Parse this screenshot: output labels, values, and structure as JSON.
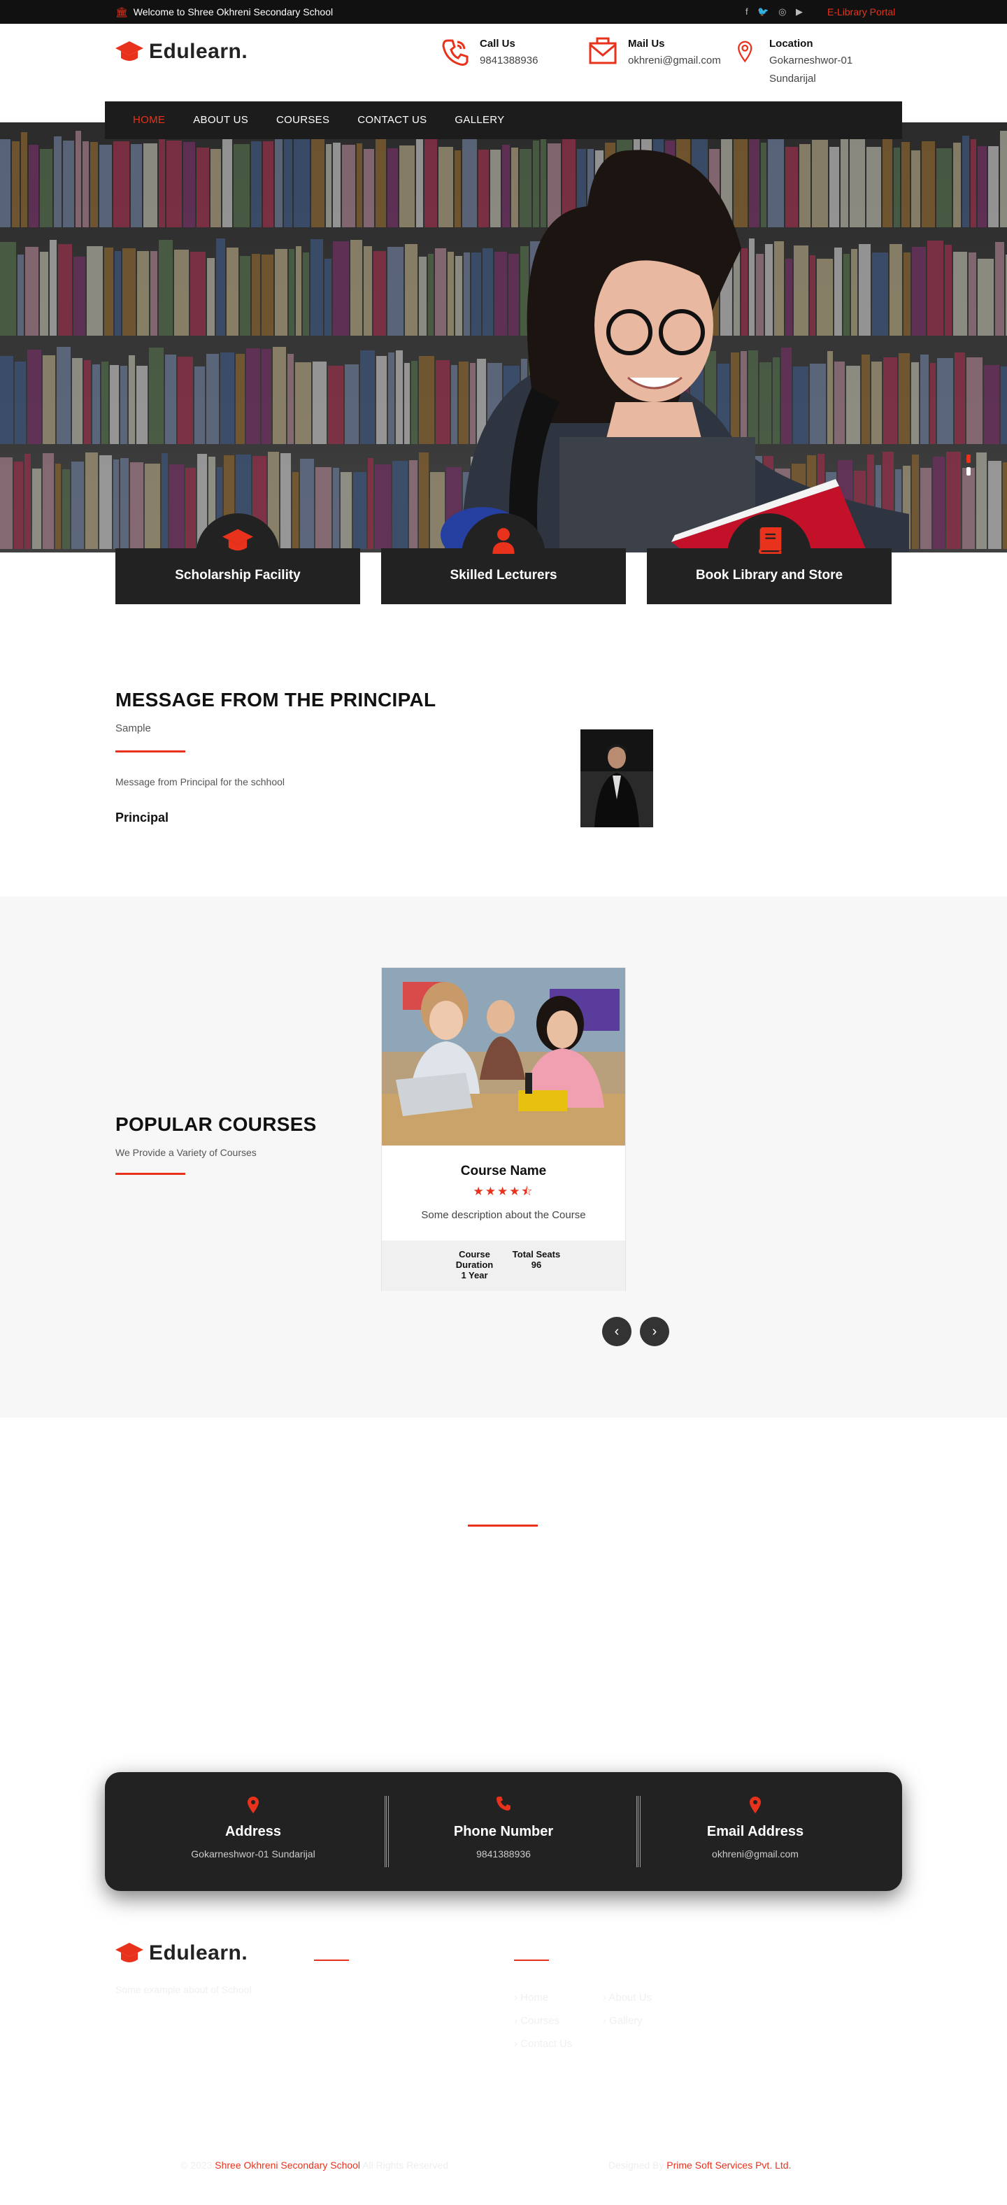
{
  "topbar": {
    "welcome": "Welcome to Shree Okhreni Secondary School",
    "social_icons": [
      "facebook-icon",
      "twitter-icon",
      "instagram-icon",
      "youtube-icon"
    ],
    "portal_link": "E-Library Portal"
  },
  "brand": {
    "name": "Edulearn.",
    "accent": "#e8321c",
    "dark": "#1c1c1c"
  },
  "header": {
    "call": {
      "label": "Call Us",
      "value": "9841388936"
    },
    "mail": {
      "label": "Mail Us",
      "value": "okhreni@gmail.com"
    },
    "location": {
      "label": "Location",
      "line1": "Gokarneshwor-01",
      "line2": "Sundarijal"
    }
  },
  "nav": {
    "items": [
      "HOME",
      "ABOUT US",
      "COURSES",
      "CONTACT US",
      "GALLERY"
    ],
    "active": "HOME"
  },
  "features": [
    {
      "icon": "graduation-cap-icon",
      "label": "Scholarship Facility"
    },
    {
      "icon": "user-icon",
      "label": "Skilled Lecturers"
    },
    {
      "icon": "book-icon",
      "label": "Book Library and Store"
    }
  ],
  "principal": {
    "heading": "MESSAGE FROM THE PRINCIPAL",
    "subtitle": "Sample",
    "message": "Message from Principal for the schhool",
    "signature": "Principal"
  },
  "courses": {
    "heading": "POPULAR COURSES",
    "subtitle": "We Provide a Variety of Courses",
    "card": {
      "name": "Course Name",
      "rating": 4.5,
      "stars": "★★★★⯪",
      "description": "Some description about the Course",
      "duration_label": "Course Duration",
      "duration_value": "1 Year",
      "seats_label": "Total Seats",
      "seats_value": "96"
    }
  },
  "contact": {
    "address": {
      "label": "Address",
      "value": "Gokarneshwor-01 Sundarijal"
    },
    "phone": {
      "label": "Phone Number",
      "value": "9841388936"
    },
    "email": {
      "label": "Email Address",
      "value": "okhreni@gmail.com"
    }
  },
  "footer": {
    "about": "Some example about of School",
    "links_col1": [
      "Home",
      "Courses",
      "Contact Us"
    ],
    "links_col2": [
      "About Us",
      "Gallery"
    ],
    "copyright_prefix": "© 2023",
    "copyright_school": "Shree Okhreni Secondary School",
    "copyright_suffix": "All Rights Reserved",
    "designed_by_label": "Designed By",
    "designed_by": "Prime Soft Services Pvt. Ltd."
  }
}
